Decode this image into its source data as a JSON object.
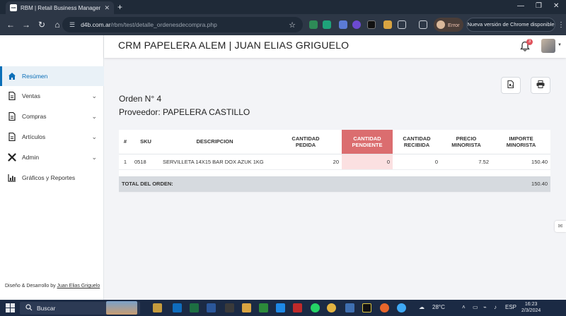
{
  "browser": {
    "tab_title": "RBM | Retail Business Managem",
    "tab_favicon": "RBM",
    "url_domain": "d4b.com.ar",
    "url_path": "/rbm/test/detalle_ordenesdecompra.php",
    "profile_status": "Error",
    "update_label": "Nueva versión de Chrome disponible"
  },
  "header": {
    "title": "CRM PAPELERA ALEM | JUAN ELIAS GRIGUELO",
    "notification_count": "3"
  },
  "sidebar": {
    "items": [
      {
        "label": "Resúmen",
        "icon": "home-icon",
        "active": true
      },
      {
        "label": "Ventas",
        "icon": "document-icon",
        "has_submenu": true
      },
      {
        "label": "Compras",
        "icon": "document-icon",
        "has_submenu": true
      },
      {
        "label": "Artículos",
        "icon": "document-icon",
        "has_submenu": true
      },
      {
        "label": "Admin",
        "icon": "tools-icon",
        "has_submenu": true
      },
      {
        "label": "Gráficos y Reportes",
        "icon": "chart-icon"
      }
    ],
    "footer_prefix": "Diseño & Desarrollo by ",
    "footer_author": "Juan Elias Griguelo"
  },
  "order": {
    "number_label": "Orden N° 4",
    "supplier_label": "Proveedor: PAPELERA CASTILLO"
  },
  "table": {
    "headers": {
      "num": "#",
      "sku": "SKU",
      "desc": "DESCRIPCION",
      "pedida_1": "CANTIDAD",
      "pedida_2": "PEDIDA",
      "pend_1": "CANTIDAD",
      "pend_2": "PENDIENTE",
      "recib_1": "CANTIDAD",
      "recib_2": "RECIBIDA",
      "precio_1": "PRECIO",
      "precio_2": "MINORISTA",
      "importe_1": "IMPORTE",
      "importe_2": "MINORISTA"
    },
    "rows": [
      {
        "num": "1",
        "sku": "0518",
        "desc": "SERVILLETA 14X15 BAR DOX AZUK 1KG",
        "pedida": "20",
        "pendiente": "0",
        "recibida": "0",
        "precio": "7.52",
        "importe": "150.40"
      }
    ],
    "total_label": "TOTAL DEL ORDEN:",
    "total_value": "150.40"
  },
  "taskbar": {
    "search_label": "Buscar",
    "weather": "28°C",
    "language": "ESP",
    "time": "16:23",
    "date": "2/3/2024"
  },
  "colors": {
    "accent": "#0b6fb8",
    "pending_header": "#db6d6f",
    "pending_cell": "#fbe0e1",
    "total_row": "#d6dadf"
  }
}
